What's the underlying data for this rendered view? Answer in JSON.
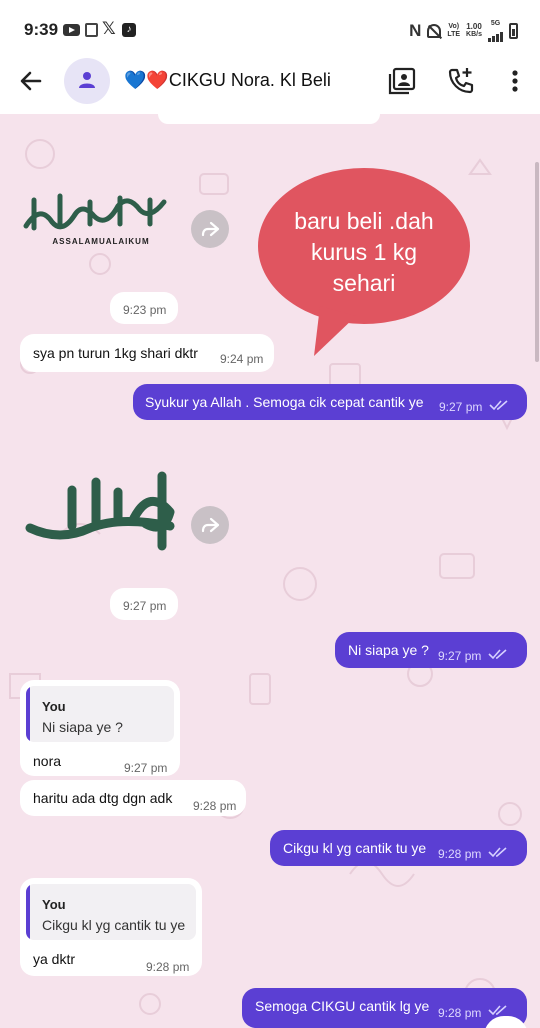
{
  "status_bar": {
    "time": "9:39",
    "x_glyph": "𝕏",
    "volte": "Vo)\nLTE",
    "speed_value": "1.00",
    "speed_unit": "KB/s",
    "network": "5G"
  },
  "header": {
    "hearts": "💙❤️",
    "contact_name": "CIKGU Nora. Kl Beli"
  },
  "messages": {
    "m1_sticker_text": "ASSALAMUALAIKUM",
    "m1_balloon": "baru beli .dah kurus 1 kg sehari",
    "m1_balloon_line1": "baru beli .dah",
    "m1_balloon_line2": "kurus 1 kg",
    "m1_balloon_line3": "sehari",
    "m1_time": "9:23 pm",
    "m2_text": "sya pn turun 1kg shari dktr",
    "m2_time": "9:24 pm",
    "m3_text": "Syukur ya Allah . Semoga cik cepat cantik ye",
    "m3_time": "9:27 pm",
    "m4_time": "9:27 pm",
    "m5_text": "Ni siapa ye ?",
    "m5_time": "9:27 pm",
    "m6_quote_name": "You",
    "m6_quote_text": "Ni siapa ye ?",
    "m6_text": "nora",
    "m6_time": "9:27 pm",
    "m7_text": "haritu ada dtg dgn adk",
    "m7_time": "9:28 pm",
    "m8_text": "Cikgu kl yg cantik tu ye",
    "m8_time": "9:28 pm",
    "m9_quote_name": "You",
    "m9_quote_text": "Cikgu kl yg cantik tu ye",
    "m9_text": "ya dktr",
    "m9_time": "9:28 pm",
    "m10_text": "Semoga CIKGU cantik lg ye",
    "m10_time": "9:28 pm"
  },
  "colors": {
    "outgoing": "#5b3fd3",
    "incoming": "#ffffff",
    "wallpaper": "#f6e3ec",
    "balloon": "#e05560",
    "sticker_green": "#2e5e4a",
    "sticker_gold": "#d8c25a"
  }
}
